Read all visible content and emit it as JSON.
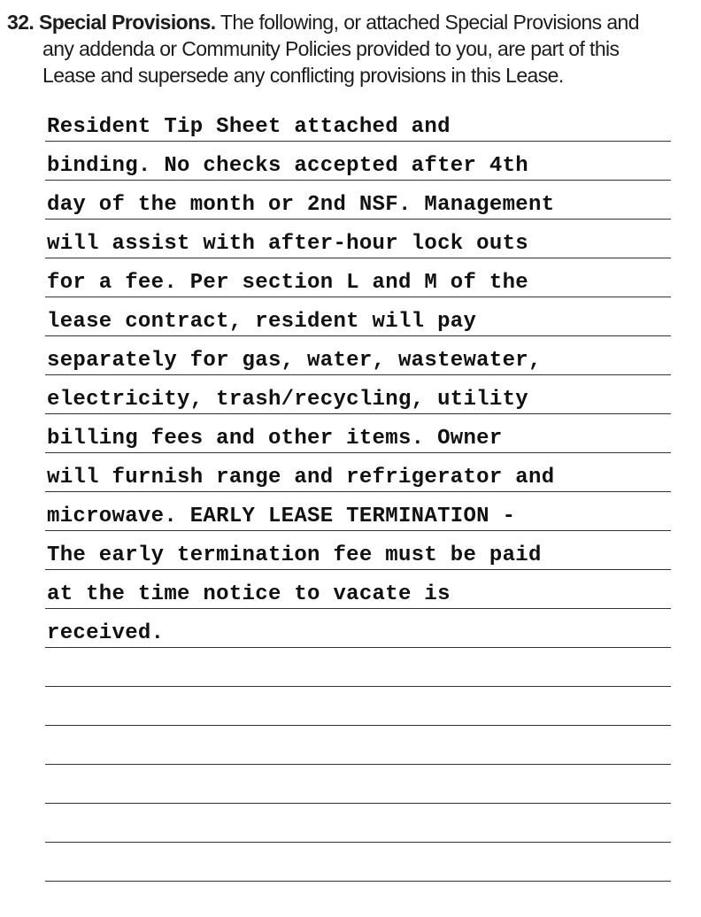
{
  "section": {
    "number": "32.",
    "title": "Special Provisions.",
    "intro_line_1": "The following, or attached Special Provisions and",
    "intro_line_2": "any addenda or Community Policies provided to you, are part of this",
    "intro_line_3": "Lease and supersede any conflicting provisions in this Lease."
  },
  "provision_lines": [
    "Resident Tip Sheet attached and",
    "binding. No checks accepted after 4th",
    "day of the month or 2nd NSF. Management",
    "will assist with after-hour lock outs",
    "for a fee. Per section L and M of the",
    "lease contract, resident will pay",
    "separately for gas, water, wastewater,",
    "electricity, trash/recycling, utility",
    "billing fees and other items. Owner",
    "will furnish range and refrigerator and",
    "microwave. EARLY LEASE TERMINATION -",
    "The early termination fee must be paid",
    "at the time notice to vacate is",
    "received.",
    "",
    "",
    "",
    "",
    "",
    ""
  ]
}
